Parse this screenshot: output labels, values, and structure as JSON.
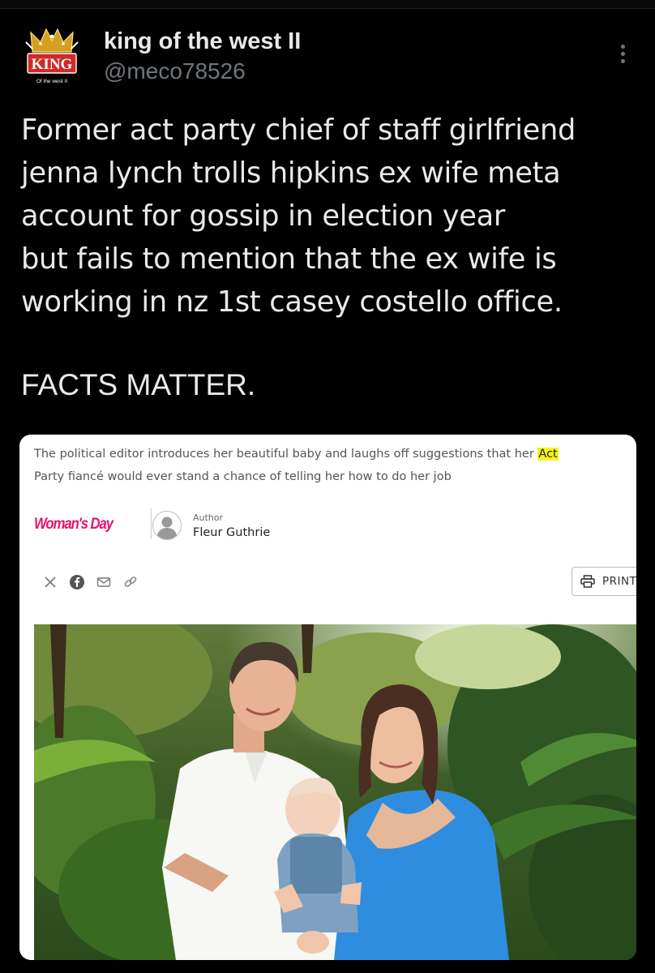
{
  "tweet": {
    "display_name": "king of the west II",
    "handle": "@meco78526",
    "avatar": {
      "logo_text": "KING",
      "logo_caption": "Of the west II",
      "icon": "crown-icon"
    },
    "text": "Former act party chief of staff girlfriend\njenna lynch trolls hipkins ex wife meta\naccount for gossip in election year\nbut fails to mention that the ex wife is\nworking in nz 1st casey costello office.",
    "closing": "FACTS MATTER.",
    "more_icon": "more-vertical-icon"
  },
  "article": {
    "subhead_before": "The political editor introduces her beautiful baby and laughs off suggestions that her ",
    "subhead_highlight": "Act",
    "subhead_after": "\nParty fiancé would ever stand a chance of telling her how to do her job",
    "highlight_color": "#f7f21c",
    "publication": "Woman's Day",
    "publication_color": "#e6136f",
    "author_label": "Author",
    "author_name": "Fleur Guthrie",
    "share_icons": [
      "x-icon",
      "facebook-icon",
      "email-icon",
      "link-icon"
    ],
    "print_label": "PRINT",
    "photo_icon": "family-photo-icon"
  }
}
